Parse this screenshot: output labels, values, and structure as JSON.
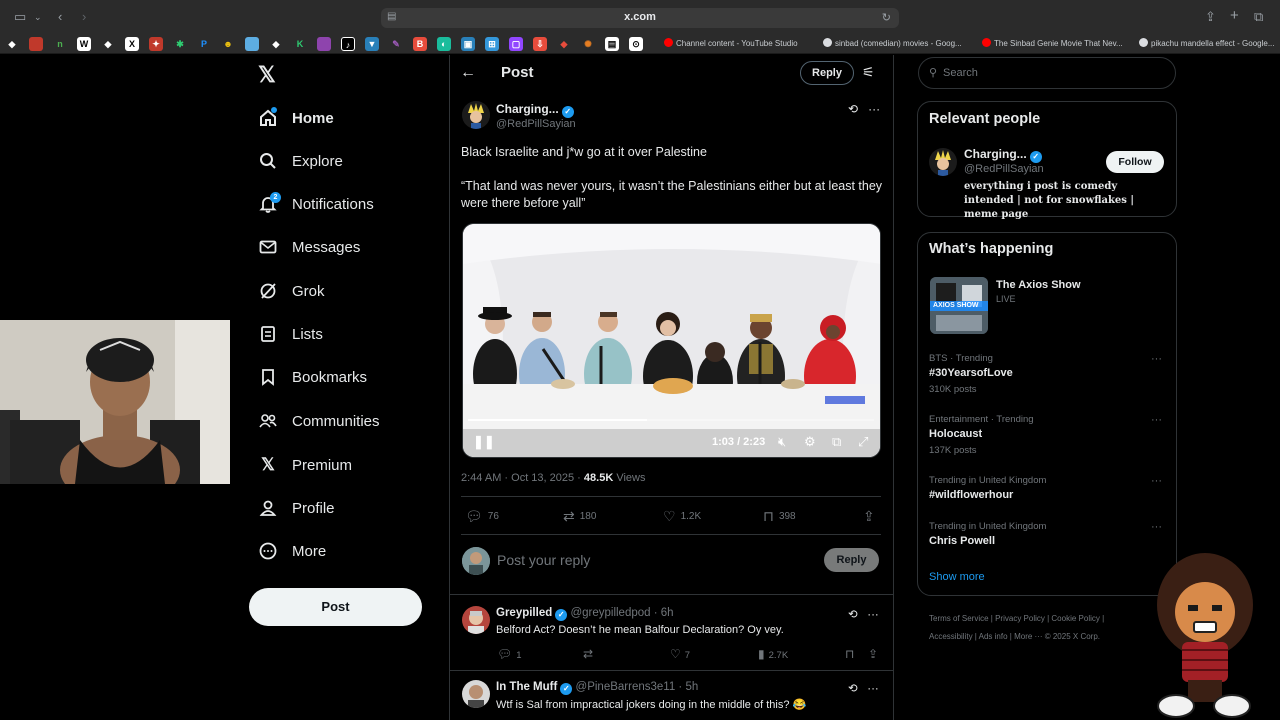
{
  "browser": {
    "url": "x.com",
    "bookmark_tabs": [
      {
        "label": "Channel content - YouTube Studio",
        "color": "#ff0000"
      },
      {
        "label": "sinbad (comedian) movies - Goog...",
        "color": "#dadce0"
      },
      {
        "label": "The Sinbad Genie Movie That Nev...",
        "color": "#ff0000"
      },
      {
        "label": "pikachu mandella effect - Google...",
        "color": "#dadce0"
      }
    ]
  },
  "sidebar": {
    "nav": [
      {
        "label": "Home",
        "icon": "home-icon",
        "active": true
      },
      {
        "label": "Explore",
        "icon": "search-icon"
      },
      {
        "label": "Notifications",
        "icon": "bell-icon",
        "badge": "2"
      },
      {
        "label": "Messages",
        "icon": "envelope-icon"
      },
      {
        "label": "Grok",
        "icon": "grok-icon"
      },
      {
        "label": "Lists",
        "icon": "list-icon"
      },
      {
        "label": "Bookmarks",
        "icon": "bookmark-icon"
      },
      {
        "label": "Communities",
        "icon": "people-icon"
      },
      {
        "label": "Premium",
        "icon": "x-icon"
      },
      {
        "label": "Profile",
        "icon": "person-icon"
      },
      {
        "label": "More",
        "icon": "more-circle-icon"
      }
    ],
    "post_button": "Post"
  },
  "header": {
    "title": "Post",
    "reply_button": "Reply"
  },
  "post": {
    "author_name": "Charging...",
    "author_handle": "@RedPillSayian",
    "text": "Black Israelite and j*w go at it over Palestine\n\n“That land was never yours, it wasn’t the Palestinians either but at least they were there before yall”",
    "video": {
      "time": "1:03 / 2:23",
      "progress": 0.44
    },
    "timestamp": "2:44 AM · Oct 13, 2025 · ",
    "views_count": "48.5K",
    "views_label": " Views",
    "actions": {
      "replies": "76",
      "reposts": "180",
      "likes": "1.2K",
      "bookmarks": "398"
    }
  },
  "reply_box": {
    "placeholder": "Post your reply",
    "button": "Reply"
  },
  "comments": [
    {
      "name": "Greypilled",
      "meta": "@greypilledpod · 6h",
      "text": "Belford Act? Doesn’t he mean Balfour Declaration? Oy vey.",
      "replies": "1",
      "likes": "7",
      "views": "2.7K"
    },
    {
      "name": "In The Muff",
      "meta": "@PineBarrens3e11 · 5h",
      "text": "Wtf is Sal from impractical jokers doing in the middle of this? 😂"
    }
  ],
  "right": {
    "search_placeholder": "Search",
    "relevant_title": "Relevant people",
    "relevant_person": {
      "name": "Charging...",
      "handle": "@RedPillSayian",
      "bio": "everything i post is comedy intended | not for snowflakes | meme page",
      "follow": "Follow"
    },
    "happening_title": "What’s happening",
    "live_show": {
      "name": "The Axios Show",
      "status": "LIVE",
      "thumb_label": "AXIOS SHOW"
    },
    "trends": [
      {
        "category": "BTS · Trending",
        "name": "#30YearsofLove",
        "count": "310K posts"
      },
      {
        "category": "Entertainment · Trending",
        "name": "Holocaust",
        "count": "137K posts"
      },
      {
        "category": "Trending in United Kingdom",
        "name": "#wildflowerhour",
        "count": ""
      },
      {
        "category": "Trending in United Kingdom",
        "name": "Chris Powell",
        "count": ""
      }
    ],
    "show_more": "Show more",
    "footer_line1": "Terms of Service  |  Privacy Policy  |  Cookie Policy  |",
    "footer_line2": "Accessibility  |  Ads info  |  More ···   © 2025 X Corp."
  }
}
